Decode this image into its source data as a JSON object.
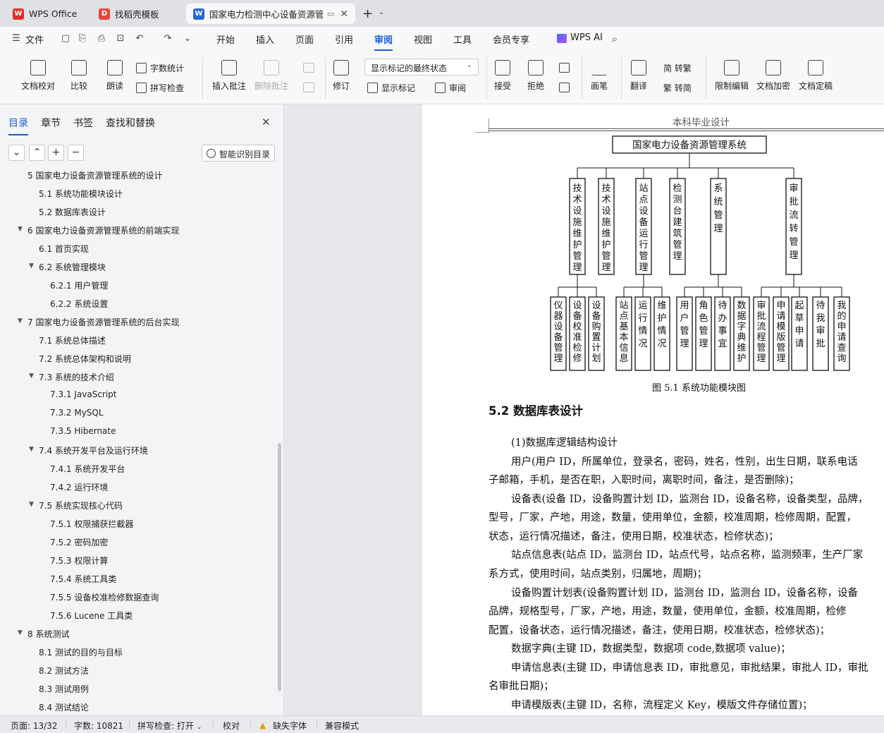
{
  "tabs": [
    {
      "label": "WPS Office"
    },
    {
      "label": "找稻壳模板"
    },
    {
      "label": "国家电力检测中心设备资源管"
    }
  ],
  "menu": {
    "file": "文件",
    "items": [
      "开始",
      "插入",
      "页面",
      "引用",
      "审阅",
      "视图",
      "工具",
      "会员专享"
    ],
    "active": "审阅",
    "ai": "WPS AI"
  },
  "ribbon": {
    "doc_check": "文档校对",
    "compare": "比较",
    "read": "朗读",
    "word_count": "字数统计",
    "spell_check": "拼写检查",
    "insert_comment": "插入批注",
    "delete_comment": "删除批注",
    "revise": "修订",
    "markup_state": "显示标记的最终状态",
    "show_markup": "显示标记",
    "review": "审阅",
    "accept": "接受",
    "reject": "拒绝",
    "pen": "画笔",
    "translate": "翻译",
    "to_traditional": "简 转繁",
    "to_simplified": "繁 转简",
    "restrict_edit": "限制编辑",
    "encrypt": "文档加密",
    "finalize": "文档定稿"
  },
  "panel": {
    "tabs": [
      "目录",
      "章节",
      "书签",
      "查找和替换"
    ],
    "smart_toc": "智能识别目录",
    "toc": [
      {
        "label": "5  国家电力设备资源管理系统的设计",
        "level": 1
      },
      {
        "label": "5.1  系统功能模块设计",
        "level": 2
      },
      {
        "label": "5.2  数据库表设计",
        "level": 2
      },
      {
        "label": "6  国家电力设备资源管理系统的前端实现",
        "level": 1
      },
      {
        "label": "6.1  首页实现",
        "level": 2
      },
      {
        "label": "6.2  系统管理模块",
        "level": 2
      },
      {
        "label": "6.2.1  用户管理",
        "level": 3
      },
      {
        "label": "6.2.2  系统设置",
        "level": 3
      },
      {
        "label": "7  国家电力设备资源管理系统的后台实现",
        "level": 1
      },
      {
        "label": "7.1  系统总体描述",
        "level": 2
      },
      {
        "label": "7.2  系统总体架构和说明",
        "level": 2
      },
      {
        "label": "7.3  系统的技术介绍",
        "level": 2
      },
      {
        "label": "7.3.1  JavaScript",
        "level": 3
      },
      {
        "label": "7.3.2  MySQL",
        "level": 3
      },
      {
        "label": "7.3.5  Hibernate",
        "level": 3
      },
      {
        "label": "7.4  系统开发平台及运行环境",
        "level": 2
      },
      {
        "label": "7.4.1  系统开发平台",
        "level": 3
      },
      {
        "label": "7.4.2  运行环境",
        "level": 3
      },
      {
        "label": "7.5  系统实现核心代码",
        "level": 2
      },
      {
        "label": "7.5.1  权限捕获拦截器",
        "level": 3
      },
      {
        "label": "7.5.2  密码加密",
        "level": 3
      },
      {
        "label": "7.5.3  权限计算",
        "level": 3
      },
      {
        "label": "7.5.4  系统工具类",
        "level": 3
      },
      {
        "label": "7.5.5  设备校准检修数据查询",
        "level": 3
      },
      {
        "label": "7.5.6  Lucene 工具类",
        "level": 3
      },
      {
        "label": "8  系统测试",
        "level": 1
      },
      {
        "label": "8.1  测试的目的与目标",
        "level": 2
      },
      {
        "label": "8.2  测试方法",
        "level": 2
      },
      {
        "label": "8.3  测试用例",
        "level": 2
      },
      {
        "label": "8.4  测试结论",
        "level": 2
      }
    ]
  },
  "doc": {
    "header": "本科毕业设计",
    "diagram": {
      "root": "国家电力设备资源管理系统",
      "modules": [
        "技术设施维护管理",
        "技术设施维护管理",
        "站点设备运行管理",
        "检测台建筑管理",
        "系统管理",
        "审批流转管理"
      ],
      "subs": [
        "仪器设备管理",
        "设备校准检修",
        "设备购置计划",
        "站点基本信息",
        "运行情况",
        "维护情况",
        "用户管理",
        "角色管理",
        "待办事宜",
        "数据字典维护",
        "审批流程管理",
        "申请模版管理",
        "起草申请",
        "待我审批",
        "我的申请查询"
      ]
    },
    "caption": "图 5.1  系统功能模块图",
    "heading": "5.2  数据库表设计",
    "paras": [
      "(1)数据库逻辑结构设计",
      "用户(用户 ID，所属单位，登录名，密码，姓名，性别，出生日期，联系电话",
      "子邮箱，手机，是否在职，入职时间，离职时间，备注，是否删除)；",
      "设备表(设备 ID，设备购置计划 ID，监测台 ID，设备名称，设备类型，品牌，",
      "型号，厂家，产地，用途，数量，使用单位，金额，校准周期，检修周期，配置，",
      "状态，运行情况描述，备注，使用日期，校准状态，检修状态)；",
      "站点信息表(站点 ID，监测台 ID，站点代号，站点名称，监测频率，生产厂家",
      "系方式，使用时间，站点类别，归属地，周期)；",
      "设备购置计划表(设备购置计划 ID，监测台 ID，监测台 ID，设备名称，设备",
      "品牌，规格型号，厂家，产地，用途，数量，使用单位，金额，校准周期，检修",
      "配置，设备状态，运行情况描述，备注，使用日期，校准状态，检修状态)；",
      "数据字典(主键 ID，数据类型，数据项 code,数据项  value)；",
      "申请信息表(主键 ID，申请信息表 ID，审批意见，审批结果，审批人 ID，审批",
      "名审批日期)；",
      "申请模版表(主键 ID，名称，流程定义 Key，模版文件存储位置)；"
    ]
  },
  "status": {
    "page": "页面: 13/32",
    "words": "字数: 10821",
    "spell": "拼写检查: 打开",
    "proof": "校对",
    "missing_font": "缺失字体",
    "compat": "兼容模式"
  }
}
